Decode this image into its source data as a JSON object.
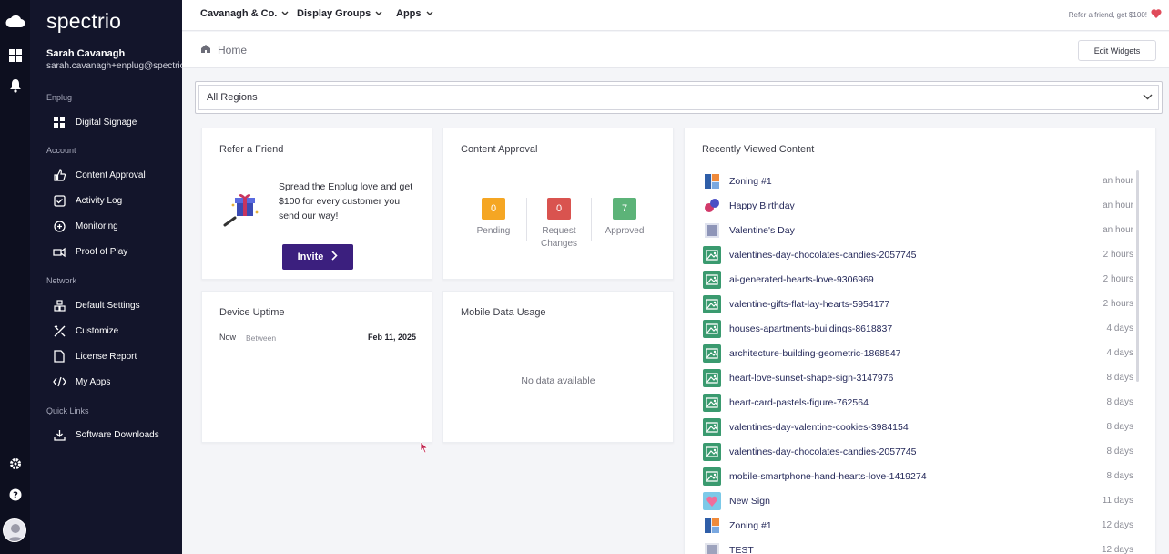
{
  "sidebar": {
    "logo": "spectrio",
    "user_name": "Sarah Cavanagh",
    "user_email": "sarah.cavanagh+enplug@spectrio",
    "sections": [
      {
        "label": "Enplug",
        "items": [
          {
            "label": "Digital Signage",
            "icon": "grid-icon"
          }
        ]
      },
      {
        "label": "Account",
        "items": [
          {
            "label": "Content Approval",
            "icon": "thumbs-up-icon"
          },
          {
            "label": "Activity Log",
            "icon": "checkbox-icon"
          },
          {
            "label": "Monitoring",
            "icon": "monitor-icon"
          },
          {
            "label": "Proof of Play",
            "icon": "proof-icon"
          }
        ]
      },
      {
        "label": "Network",
        "items": [
          {
            "label": "Default Settings",
            "icon": "settings-blocks-icon"
          },
          {
            "label": "Customize",
            "icon": "tools-icon"
          },
          {
            "label": "License Report",
            "icon": "document-icon"
          },
          {
            "label": "My Apps",
            "icon": "code-icon"
          }
        ]
      },
      {
        "label": "Quick Links",
        "items": [
          {
            "label": "Software Downloads",
            "icon": "download-icon"
          }
        ]
      }
    ]
  },
  "topbar": {
    "menus": [
      "Cavanagh & Co.",
      "Display Groups",
      "Apps"
    ],
    "refer_text": "Refer a friend, get $100!"
  },
  "breadcrumb": {
    "home": "Home"
  },
  "edit_widgets": "Edit Widgets",
  "region_select": {
    "value": "All Regions"
  },
  "refer_card": {
    "title": "Refer a Friend",
    "text": "Spread the Enplug love and get $100 for every customer you send our way!",
    "button": "Invite"
  },
  "approval_card": {
    "title": "Content Approval",
    "stats": [
      {
        "count": "0",
        "label": "Pending",
        "color": "#f5a623"
      },
      {
        "count": "0",
        "label": "Request Changes",
        "color": "#d9534f"
      },
      {
        "count": "7",
        "label": "Approved",
        "color": "#5cb378"
      }
    ]
  },
  "uptime_card": {
    "title": "Device Uptime",
    "now": "Now",
    "between": "Between",
    "date": "Feb 11, 2025"
  },
  "mobile_card": {
    "title": "Mobile Data Usage",
    "empty": "No data available"
  },
  "recent_card": {
    "title": "Recently Viewed Content",
    "items": [
      {
        "name": "Zoning #1",
        "time": "an hour",
        "thumb": "zoning"
      },
      {
        "name": "Happy Birthday",
        "time": "an hour",
        "thumb": "birthday"
      },
      {
        "name": "Valentine's Day",
        "time": "an hour",
        "thumb": "valentine"
      },
      {
        "name": "valentines-day-chocolates-candies-2057745",
        "time": "2 hours",
        "thumb": "image"
      },
      {
        "name": "ai-generated-hearts-love-9306969",
        "time": "2 hours",
        "thumb": "image"
      },
      {
        "name": "valentine-gifts-flat-lay-hearts-5954177",
        "time": "2 hours",
        "thumb": "image"
      },
      {
        "name": "houses-apartments-buildings-8618837",
        "time": "4 days",
        "thumb": "image"
      },
      {
        "name": "architecture-building-geometric-1868547",
        "time": "4 days",
        "thumb": "image"
      },
      {
        "name": "heart-love-sunset-shape-sign-3147976",
        "time": "8 days",
        "thumb": "image"
      },
      {
        "name": "heart-card-pastels-figure-762564",
        "time": "8 days",
        "thumb": "image"
      },
      {
        "name": "valentines-day-valentine-cookies-3984154",
        "time": "8 days",
        "thumb": "image"
      },
      {
        "name": "valentines-day-chocolates-candies-2057745",
        "time": "8 days",
        "thumb": "image"
      },
      {
        "name": "mobile-smartphone-hand-hearts-love-1419274",
        "time": "8 days",
        "thumb": "image"
      },
      {
        "name": "New Sign",
        "time": "11 days",
        "thumb": "sign"
      },
      {
        "name": "Zoning #1",
        "time": "12 days",
        "thumb": "zoning"
      },
      {
        "name": "TEST",
        "time": "12 days",
        "thumb": "test"
      }
    ]
  },
  "colors": {
    "sidebar_bg": "#13152b",
    "rail_bg": "#0d0f1f",
    "invite_bg": "#3b1f7e",
    "image_thumb": "#3a9a6f",
    "heart": "#e04b5a"
  }
}
